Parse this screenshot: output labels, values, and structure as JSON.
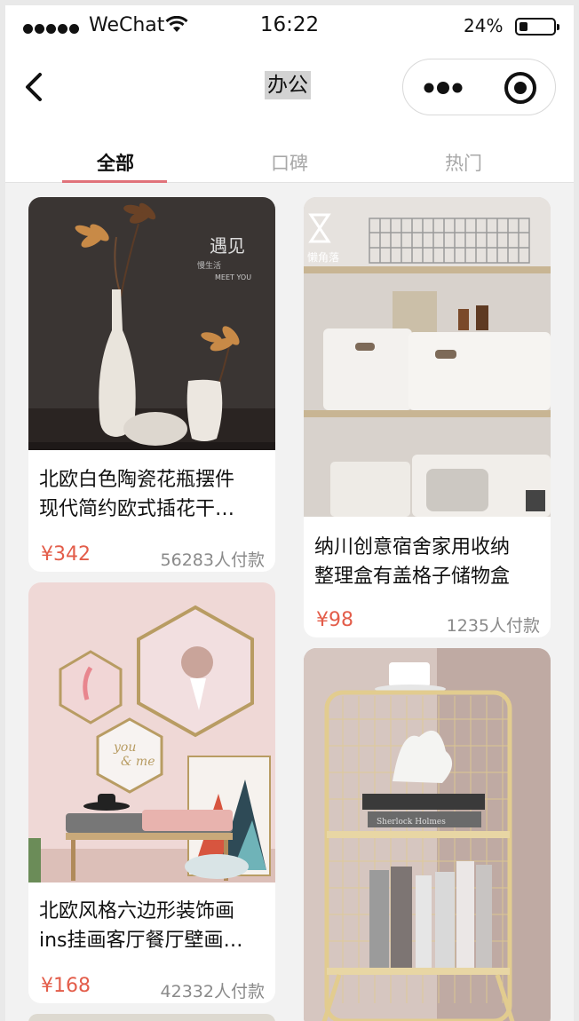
{
  "status_bar": {
    "carrier": "WeChat",
    "time": "16:22",
    "battery_percent": "24%"
  },
  "nav": {
    "title": "办公"
  },
  "tabs": [
    {
      "label": "全部",
      "active": true
    },
    {
      "label": "口碑",
      "active": false
    },
    {
      "label": "热门",
      "active": false
    }
  ],
  "products": [
    {
      "name_line1": "北欧白色陶瓷花瓶摆件",
      "name_line2": "现代简约欧式插花干…",
      "price": "¥342",
      "sold": "56283人付款",
      "image_text_1": "遇见",
      "image_text_2": "慢生活",
      "image_text_3": "MEET YOU"
    },
    {
      "name_line1": "纳川创意宿舍家用收纳",
      "name_line2": "整理盒有盖格子储物盒",
      "price": "¥98",
      "sold": "1235人付款",
      "image_text_1": "懒角落"
    },
    {
      "name_line1": "北欧风格六边形装饰画",
      "name_line2": "ins挂画客厅餐厅壁画…",
      "price": "¥168",
      "sold": "42332人付款",
      "image_text_1": "you",
      "image_text_2": "& me"
    },
    {
      "image_text_1": "Sherlock Holmes"
    }
  ],
  "colors": {
    "accent": "#e0727a",
    "price": "#e35d4a",
    "page_bg": "#f2f2f2"
  }
}
